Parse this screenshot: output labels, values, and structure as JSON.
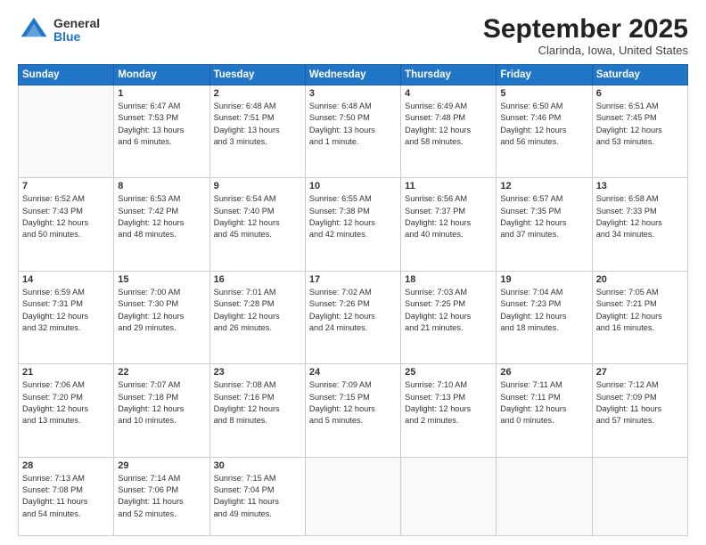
{
  "header": {
    "logo_general": "General",
    "logo_blue": "Blue",
    "month_title": "September 2025",
    "location": "Clarinda, Iowa, United States"
  },
  "days_of_week": [
    "Sunday",
    "Monday",
    "Tuesday",
    "Wednesday",
    "Thursday",
    "Friday",
    "Saturday"
  ],
  "weeks": [
    [
      {
        "day": "",
        "info": ""
      },
      {
        "day": "1",
        "info": "Sunrise: 6:47 AM\nSunset: 7:53 PM\nDaylight: 13 hours\nand 6 minutes."
      },
      {
        "day": "2",
        "info": "Sunrise: 6:48 AM\nSunset: 7:51 PM\nDaylight: 13 hours\nand 3 minutes."
      },
      {
        "day": "3",
        "info": "Sunrise: 6:48 AM\nSunset: 7:50 PM\nDaylight: 13 hours\nand 1 minute."
      },
      {
        "day": "4",
        "info": "Sunrise: 6:49 AM\nSunset: 7:48 PM\nDaylight: 12 hours\nand 58 minutes."
      },
      {
        "day": "5",
        "info": "Sunrise: 6:50 AM\nSunset: 7:46 PM\nDaylight: 12 hours\nand 56 minutes."
      },
      {
        "day": "6",
        "info": "Sunrise: 6:51 AM\nSunset: 7:45 PM\nDaylight: 12 hours\nand 53 minutes."
      }
    ],
    [
      {
        "day": "7",
        "info": "Sunrise: 6:52 AM\nSunset: 7:43 PM\nDaylight: 12 hours\nand 50 minutes."
      },
      {
        "day": "8",
        "info": "Sunrise: 6:53 AM\nSunset: 7:42 PM\nDaylight: 12 hours\nand 48 minutes."
      },
      {
        "day": "9",
        "info": "Sunrise: 6:54 AM\nSunset: 7:40 PM\nDaylight: 12 hours\nand 45 minutes."
      },
      {
        "day": "10",
        "info": "Sunrise: 6:55 AM\nSunset: 7:38 PM\nDaylight: 12 hours\nand 42 minutes."
      },
      {
        "day": "11",
        "info": "Sunrise: 6:56 AM\nSunset: 7:37 PM\nDaylight: 12 hours\nand 40 minutes."
      },
      {
        "day": "12",
        "info": "Sunrise: 6:57 AM\nSunset: 7:35 PM\nDaylight: 12 hours\nand 37 minutes."
      },
      {
        "day": "13",
        "info": "Sunrise: 6:58 AM\nSunset: 7:33 PM\nDaylight: 12 hours\nand 34 minutes."
      }
    ],
    [
      {
        "day": "14",
        "info": "Sunrise: 6:59 AM\nSunset: 7:31 PM\nDaylight: 12 hours\nand 32 minutes."
      },
      {
        "day": "15",
        "info": "Sunrise: 7:00 AM\nSunset: 7:30 PM\nDaylight: 12 hours\nand 29 minutes."
      },
      {
        "day": "16",
        "info": "Sunrise: 7:01 AM\nSunset: 7:28 PM\nDaylight: 12 hours\nand 26 minutes."
      },
      {
        "day": "17",
        "info": "Sunrise: 7:02 AM\nSunset: 7:26 PM\nDaylight: 12 hours\nand 24 minutes."
      },
      {
        "day": "18",
        "info": "Sunrise: 7:03 AM\nSunset: 7:25 PM\nDaylight: 12 hours\nand 21 minutes."
      },
      {
        "day": "19",
        "info": "Sunrise: 7:04 AM\nSunset: 7:23 PM\nDaylight: 12 hours\nand 18 minutes."
      },
      {
        "day": "20",
        "info": "Sunrise: 7:05 AM\nSunset: 7:21 PM\nDaylight: 12 hours\nand 16 minutes."
      }
    ],
    [
      {
        "day": "21",
        "info": "Sunrise: 7:06 AM\nSunset: 7:20 PM\nDaylight: 12 hours\nand 13 minutes."
      },
      {
        "day": "22",
        "info": "Sunrise: 7:07 AM\nSunset: 7:18 PM\nDaylight: 12 hours\nand 10 minutes."
      },
      {
        "day": "23",
        "info": "Sunrise: 7:08 AM\nSunset: 7:16 PM\nDaylight: 12 hours\nand 8 minutes."
      },
      {
        "day": "24",
        "info": "Sunrise: 7:09 AM\nSunset: 7:15 PM\nDaylight: 12 hours\nand 5 minutes."
      },
      {
        "day": "25",
        "info": "Sunrise: 7:10 AM\nSunset: 7:13 PM\nDaylight: 12 hours\nand 2 minutes."
      },
      {
        "day": "26",
        "info": "Sunrise: 7:11 AM\nSunset: 7:11 PM\nDaylight: 12 hours\nand 0 minutes."
      },
      {
        "day": "27",
        "info": "Sunrise: 7:12 AM\nSunset: 7:09 PM\nDaylight: 11 hours\nand 57 minutes."
      }
    ],
    [
      {
        "day": "28",
        "info": "Sunrise: 7:13 AM\nSunset: 7:08 PM\nDaylight: 11 hours\nand 54 minutes."
      },
      {
        "day": "29",
        "info": "Sunrise: 7:14 AM\nSunset: 7:06 PM\nDaylight: 11 hours\nand 52 minutes."
      },
      {
        "day": "30",
        "info": "Sunrise: 7:15 AM\nSunset: 7:04 PM\nDaylight: 11 hours\nand 49 minutes."
      },
      {
        "day": "",
        "info": ""
      },
      {
        "day": "",
        "info": ""
      },
      {
        "day": "",
        "info": ""
      },
      {
        "day": "",
        "info": ""
      }
    ]
  ]
}
